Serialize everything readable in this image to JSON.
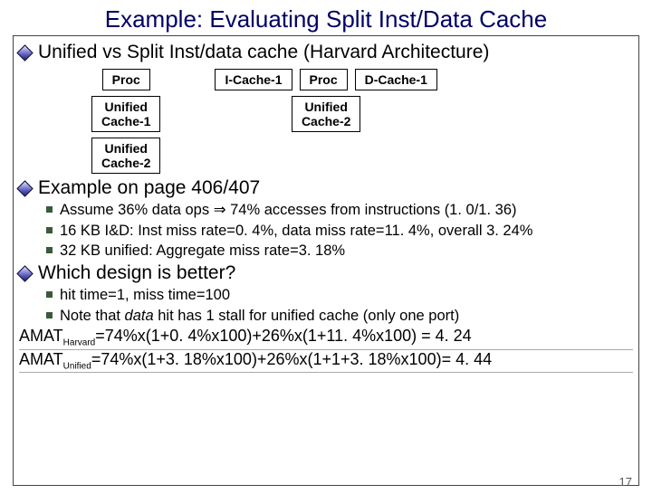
{
  "title": "Example: Evaluating Split Inst/Data Cache",
  "heading1": "Unified vs Split Inst/data cache (Harvard Architecture)",
  "diagram": {
    "left": {
      "proc": "Proc",
      "uc1": "Unified\nCache-1",
      "uc2": "Unified\nCache-2"
    },
    "right": {
      "icache": "I-Cache-1",
      "proc": "Proc",
      "dcache": "D-Cache-1",
      "uc2": "Unified\nCache-2"
    }
  },
  "heading2": "Example on page 406/407",
  "assume_a": "Assume 36% data ops ",
  "assume_b": " 74% accesses from instructions (1. 0/1. 36)",
  "kb16": "16 KB I&D: Inst miss rate=0. 4%, data miss rate=11. 4%, overall 3. 24%",
  "kb32": "32 KB unified: Aggregate miss rate=3. 18%",
  "heading3": "Which design is better?",
  "hit": "hit time=1, miss time=100",
  "note_a": "Note that ",
  "note_b": "data",
  "note_c": " hit has 1 stall for unified cache (only one port)",
  "amat_h_label": "AMAT",
  "amat_h_sub": "Harvard",
  "amat_h_eq": "=74%x(1+0. 4%x100)+26%x(1+11. 4%x100) = 4. 24",
  "amat_u_label": "AMAT",
  "amat_u_sub": "Unified",
  "amat_u_eq": "=74%x(1+3. 18%x100)+26%x(1+1+3. 18%x100)= 4. 44",
  "arrow": "⇒",
  "page_number": "17"
}
